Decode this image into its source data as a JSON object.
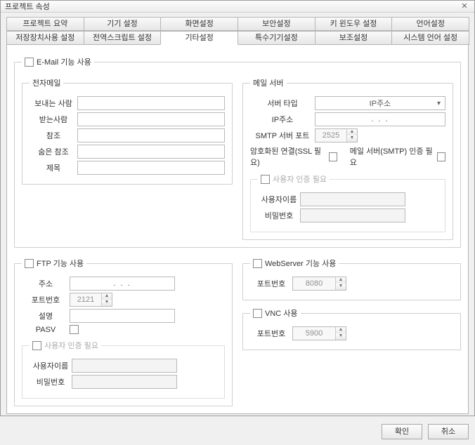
{
  "window": {
    "title": "프로젝트 속성",
    "close": "✕"
  },
  "tabs": {
    "row1": [
      "프로젝트 요약",
      "기기 설정",
      "화면설정",
      "보안설정",
      "키 윈도우 설정",
      "언어설정"
    ],
    "row2": [
      "저장장치사용 설정",
      "전역스크립트 설정",
      "기타설정",
      "특수기기설정",
      "보조설정",
      "시스템 언어 설정"
    ],
    "active": "기타설정"
  },
  "email": {
    "enable_label": "E-Mail 기능 사용",
    "group_label": "전자메일",
    "from_label": "보내는 사람",
    "to_label": "받는사람",
    "cc_label": "참조",
    "bcc_label": "숨은 참조",
    "subject_label": "제목"
  },
  "mailserver": {
    "group_label": "메일 서버",
    "server_type_label": "서버 타입",
    "server_type_value": "IP주소",
    "ip_label": "IP주소",
    "ip_value": ".       .       .",
    "smtp_port_label": "SMTP 서버 포트",
    "smtp_port_value": "2525",
    "ssl_label": "암호화된 연결(SSL 필요)",
    "smtp_auth_label": "메일 서버(SMTP) 인증 필요",
    "user_auth_group": "사용자 인증 필요",
    "user_label": "사용자이름",
    "pw_label": "비밀번호"
  },
  "ftp": {
    "enable_label": "FTP 기능 사용",
    "addr_label": "주소",
    "addr_value": ".       .       .",
    "port_label": "포트번호",
    "port_value": "2121",
    "desc_label": "설명",
    "pasv_label": "PASV",
    "user_auth_group": "사용자 인증 필요",
    "user_label": "사용자이름",
    "pw_label": "비밀번호"
  },
  "webserver": {
    "enable_label": "WebServer 기능 사용",
    "port_label": "포트번호",
    "port_value": "8080"
  },
  "vnc": {
    "enable_label": "VNC 사용",
    "port_label": "포트번호",
    "port_value": "5900"
  },
  "footer": {
    "ok": "확인",
    "cancel": "취소"
  }
}
